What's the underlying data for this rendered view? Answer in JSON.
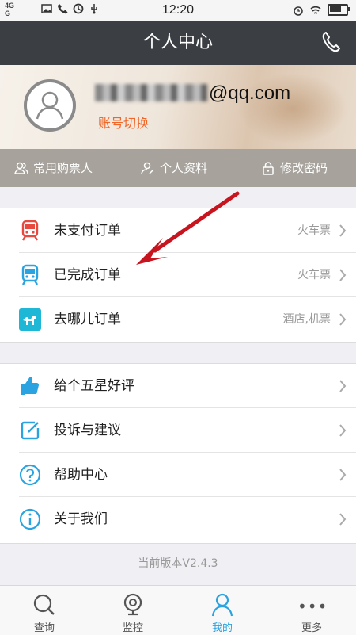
{
  "status": {
    "network_top": "4G",
    "network_bottom": "G",
    "time": "12:20",
    "battery_level": 0.8
  },
  "header": {
    "title": "个人中心"
  },
  "profile": {
    "email_suffix": "@qq.com",
    "switch_label": "账号切换"
  },
  "quick_actions": [
    {
      "label": "常用购票人",
      "icon": "passengers-icon"
    },
    {
      "label": "个人资料",
      "icon": "profile-edit-icon"
    },
    {
      "label": "修改密码",
      "icon": "lock-icon"
    }
  ],
  "orders": [
    {
      "label": "未支付订单",
      "value": "火车票",
      "icon": "train-icon-red"
    },
    {
      "label": "已完成订单",
      "value": "火车票",
      "icon": "train-icon-blue"
    },
    {
      "label": "去哪儿订单",
      "value": "酒店,机票",
      "icon": "camel-icon"
    }
  ],
  "services": [
    {
      "label": "给个五星好评",
      "icon": "thumbs-up-icon"
    },
    {
      "label": "投诉与建议",
      "icon": "edit-icon"
    },
    {
      "label": "帮助中心",
      "icon": "question-icon"
    },
    {
      "label": "关于我们",
      "icon": "info-icon"
    }
  ],
  "version": "当前版本V2.4.3",
  "tabs": [
    {
      "label": "查询",
      "icon": "search-icon"
    },
    {
      "label": "监控",
      "icon": "monitor-icon"
    },
    {
      "label": "我的",
      "icon": "user-icon",
      "active": true
    },
    {
      "label": "更多",
      "icon": "more-icon"
    }
  ],
  "colors": {
    "accent": "#2aa3e0",
    "header_bg": "#3b3f44",
    "switch": "#f0672a",
    "arrow": "#c8141e"
  }
}
